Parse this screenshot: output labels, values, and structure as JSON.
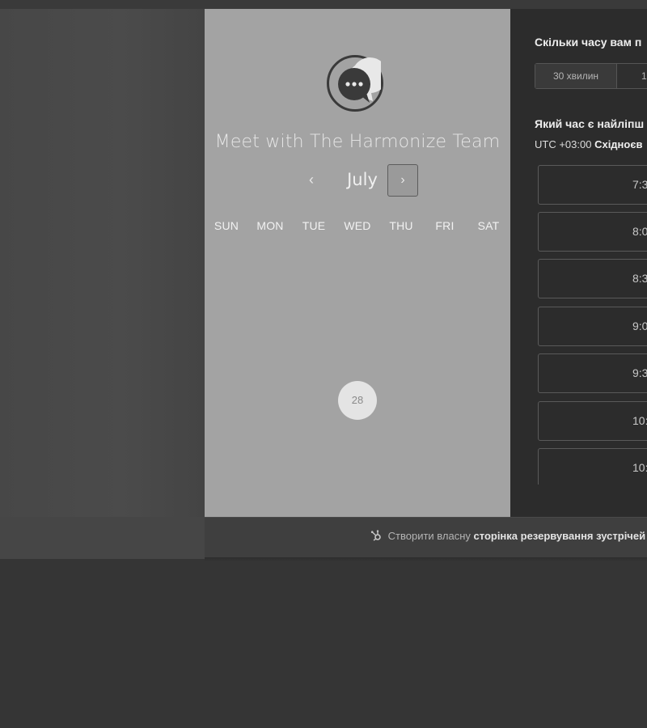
{
  "calendar": {
    "title": "Meet with The Harmonize Team",
    "month": "July",
    "prev_icon": "‹",
    "next_icon": "›",
    "weekdays": [
      "SUN",
      "MON",
      "TUE",
      "WED",
      "THU",
      "FRI",
      "SAT"
    ],
    "available_day": "28"
  },
  "booking": {
    "duration_question": "Скільки часу вам п",
    "duration_options": [
      "30 хвилин",
      "1"
    ],
    "time_question": "Який час є найліпш",
    "timezone_prefix": "UTC +03:00",
    "timezone_name": "Східноєв",
    "time_slots": [
      "7:3",
      "8:0",
      "8:3",
      "9:0",
      "9:3",
      "10:",
      "10:"
    ]
  },
  "footer": {
    "text_prefix": "Створити власну",
    "text_bold": "сторінка резервування зустрічей"
  }
}
